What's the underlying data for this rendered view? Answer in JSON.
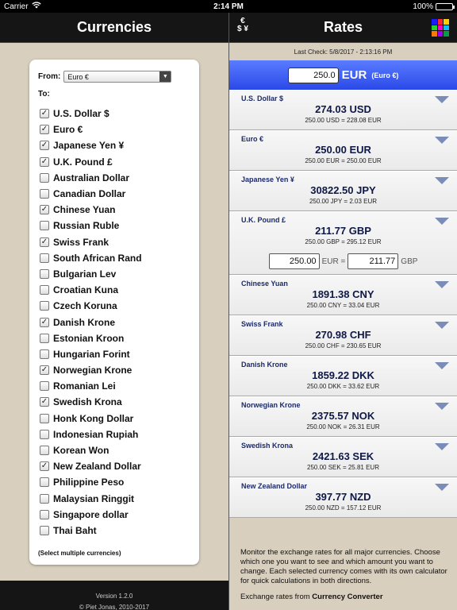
{
  "status": {
    "carrier": "Carrier",
    "time": "2:14 PM",
    "battery": "100%"
  },
  "left": {
    "title": "Currencies",
    "from_label": "From:",
    "from_value": "Euro €",
    "to_label": "To:",
    "currencies": [
      {
        "label": "U.S. Dollar $",
        "checked": true
      },
      {
        "label": "Euro €",
        "checked": true
      },
      {
        "label": "Japanese Yen ¥",
        "checked": true
      },
      {
        "label": "U.K. Pound £",
        "checked": true
      },
      {
        "label": "Australian Dollar",
        "checked": false
      },
      {
        "label": "Canadian Dollar",
        "checked": false
      },
      {
        "label": "Chinese Yuan",
        "checked": true
      },
      {
        "label": "Russian Ruble",
        "checked": false
      },
      {
        "label": "Swiss Frank",
        "checked": true
      },
      {
        "label": "South African Rand",
        "checked": false
      },
      {
        "label": "Bulgarian Lev",
        "checked": false
      },
      {
        "label": "Croatian Kuna",
        "checked": false
      },
      {
        "label": "Czech Koruna",
        "checked": false
      },
      {
        "label": "Danish Krone",
        "checked": true
      },
      {
        "label": "Estonian Kroon",
        "checked": false
      },
      {
        "label": "Hungarian Forint",
        "checked": false
      },
      {
        "label": "Norwegian Krone",
        "checked": true
      },
      {
        "label": "Romanian Lei",
        "checked": false
      },
      {
        "label": "Swedish Krona",
        "checked": true
      },
      {
        "label": "Honk Kong Dollar",
        "checked": false
      },
      {
        "label": "Indonesian Rupiah",
        "checked": false
      },
      {
        "label": "Korean Won",
        "checked": false
      },
      {
        "label": "New Zealand Dollar",
        "checked": true
      },
      {
        "label": "Philippine Peso",
        "checked": false
      },
      {
        "label": "Malaysian Ringgit",
        "checked": false
      },
      {
        "label": "Singapore dollar",
        "checked": false
      },
      {
        "label": "Thai Baht",
        "checked": false
      }
    ],
    "note": "(Select multiple currencies)",
    "version": "Version 1.2.0",
    "copyright": "© Piet Jonas, 2010-2017"
  },
  "right": {
    "title": "Rates",
    "last_check": "Last Check: 5/8/2017 - 2:13:16 PM",
    "base_amount": "250.0",
    "base_code": "EUR",
    "base_name": "(Euro €)",
    "rates": [
      {
        "name": "U.S. Dollar $",
        "value": "274.03 USD",
        "sub": "250.00 USD = 228.08 EUR"
      },
      {
        "name": "Euro €",
        "value": "250.00 EUR",
        "sub": "250.00 EUR = 250.00 EUR"
      },
      {
        "name": "Japanese Yen ¥",
        "value": "30822.50 JPY",
        "sub": "250.00 JPY = 2.03 EUR"
      },
      {
        "name": "U.K. Pound £",
        "value": "211.77 GBP",
        "sub": "250.00 GBP = 295.12 EUR",
        "calc": {
          "left": "250.00",
          "left_unit": "EUR =",
          "right": "211.77",
          "right_unit": "GBP"
        }
      },
      {
        "name": "Chinese Yuan",
        "value": "1891.38 CNY",
        "sub": "250.00 CNY = 33.04 EUR"
      },
      {
        "name": "Swiss Frank",
        "value": "270.98 CHF",
        "sub": "250.00 CHF = 230.65 EUR"
      },
      {
        "name": "Danish Krone",
        "value": "1859.22 DKK",
        "sub": "250.00 DKK = 33.62 EUR"
      },
      {
        "name": "Norwegian Krone",
        "value": "2375.57 NOK",
        "sub": "250.00 NOK = 26.31 EUR"
      },
      {
        "name": "Swedish Krona",
        "value": "2421.63 SEK",
        "sub": "250.00 SEK = 25.81 EUR"
      },
      {
        "name": "New Zealand Dollar",
        "value": "397.77 NZD",
        "sub": "250.00 NZD = 157.12 EUR"
      }
    ],
    "info": "Monitor the exchange rates for all major currencies. Choose which one you want to see and which amount you want to change. Each selected currency comes with its own calculator for quick calculations in both directions.",
    "source_prefix": "Exchange rates from ",
    "source_name": "Currency Converter"
  },
  "icons": {
    "wifi": "wifi-icon",
    "currency_symbols": "currency-symbols-icon",
    "color_grid": "color-grid-icon",
    "dropdown": "chevron-down-icon",
    "expand": "triangle-down-icon"
  },
  "colors": {
    "header_bg": "#151515",
    "base_bar": "#2a49e8",
    "pane_bg": "#d8cfbe",
    "text_navy": "#0e1846",
    "grid": [
      "#1a1aff",
      "#ff2a2a",
      "#ffcc00",
      "#2ad12a",
      "#ff00cc",
      "#00c0ff",
      "#ff7a00",
      "#9b00ff",
      "#00a040"
    ]
  }
}
